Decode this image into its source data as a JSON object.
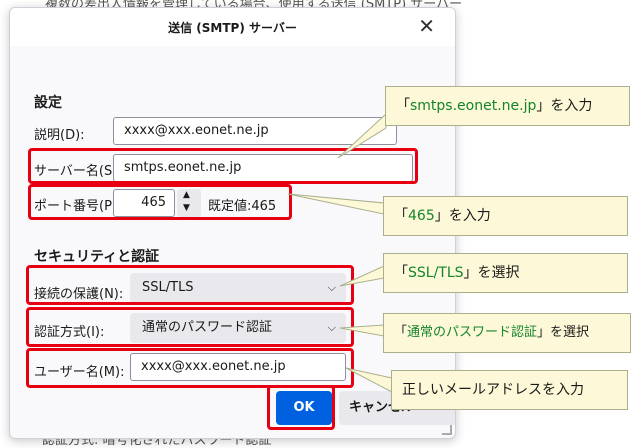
{
  "background": {
    "top_text": "複数の差出人情報を管理している場合、使用する送信 (SMTP) サーバー",
    "bottom_text": "認証方式: 暗号化されたパスワード認証"
  },
  "dialog": {
    "title": "送信 (SMTP) サーバー",
    "close_glyph": "✕",
    "settings_heading": "設定",
    "description_label": "説明(D):",
    "description_value": "xxxx@xxx.eonet.ne.jp",
    "server_label": "サーバー名(S):",
    "server_value": "smtps.eonet.ne.jp",
    "port_label": "ポート番号(P):",
    "port_value": "465",
    "port_default": "既定値:465",
    "security_heading": "セキュリティと認証",
    "connection_label": "接続の保護(N):",
    "connection_value": "SSL/TLS",
    "auth_label": "認証方式(I):",
    "auth_value": "通常のパスワード認証",
    "username_label": "ユーザー名(M):",
    "username_value": "xxxx@xxx.eonet.ne.jp",
    "ok_label": "OK",
    "cancel_label": "キャンセル"
  },
  "callouts": {
    "server": {
      "open": "「",
      "value": "smtps.eonet.ne.jp",
      "close": "」を入力"
    },
    "port": {
      "open": "「",
      "value": "465",
      "close": "」を入力"
    },
    "connection": {
      "open": "「",
      "value": "SSL/TLS",
      "close": "」を選択"
    },
    "auth": {
      "open": "「",
      "value": "通常のパスワード認証",
      "close": "」を選択"
    },
    "username": {
      "text": "正しいメールアドレスを入力"
    }
  },
  "colors": {
    "highlight_border": "#e60012",
    "callout_fill": "#fdf8d8",
    "callout_value_text": "#13852c",
    "ok_button": "#0061e0"
  }
}
